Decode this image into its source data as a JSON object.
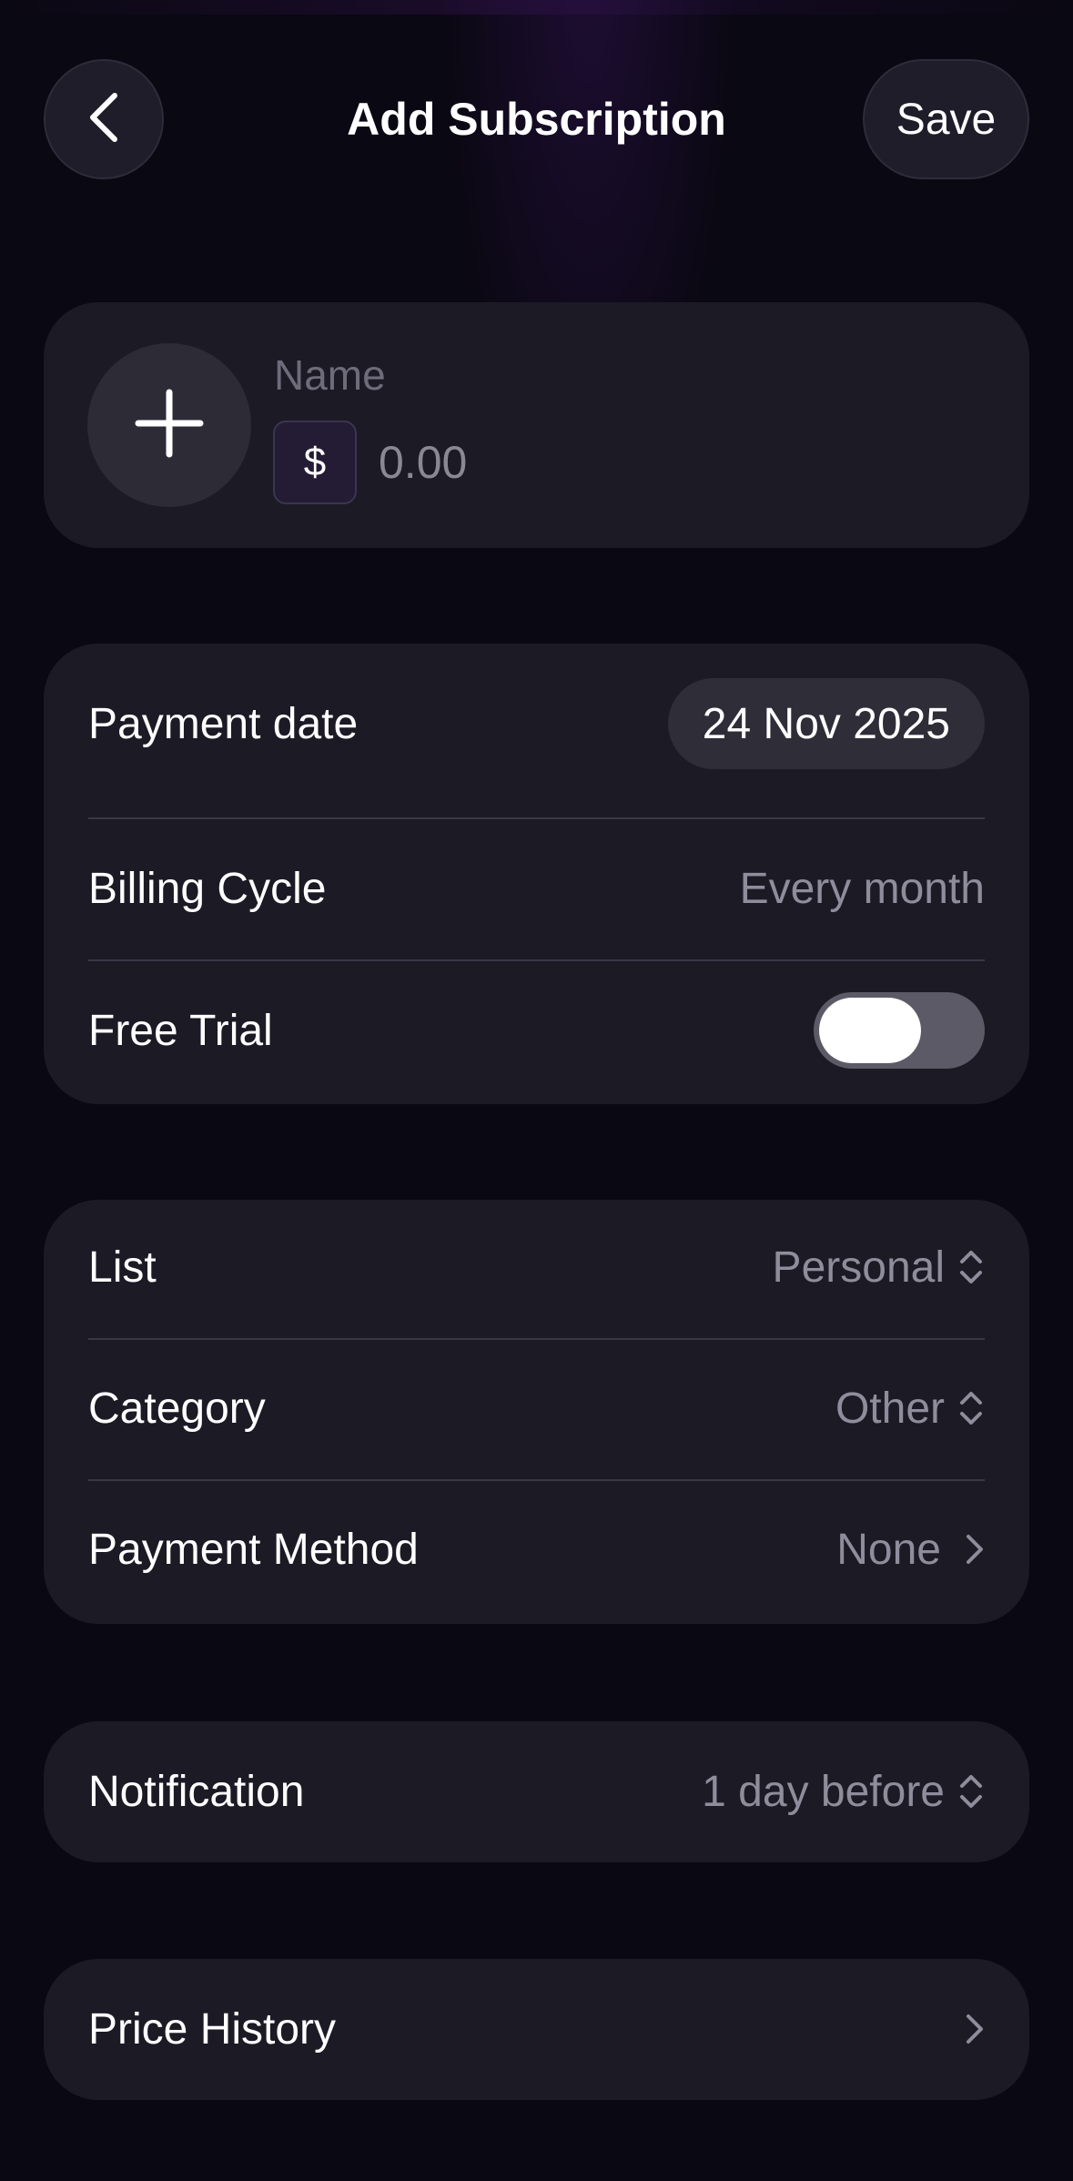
{
  "header": {
    "title": "Add Subscription",
    "save_label": "Save"
  },
  "name_card": {
    "name_placeholder": "Name",
    "currency_symbol": "$",
    "amount_placeholder": "0.00"
  },
  "payment_card": {
    "payment_date_label": "Payment date",
    "payment_date_value": "24 Nov 2025",
    "billing_cycle_label": "Billing Cycle",
    "billing_cycle_value": "Every month",
    "free_trial_label": "Free Trial",
    "free_trial_on": false
  },
  "list_card": {
    "list_label": "List",
    "list_value": "Personal",
    "category_label": "Category",
    "category_value": "Other",
    "payment_method_label": "Payment Method",
    "payment_method_value": "None"
  },
  "notification_card": {
    "label": "Notification",
    "value": "1 day before"
  },
  "price_history_card": {
    "label": "Price History"
  },
  "icons": {
    "back": "chevron-left-icon",
    "add": "plus-icon",
    "updown": "chevron-up-down-icon",
    "right": "chevron-right-icon"
  },
  "colors": {
    "background": "#0a0812",
    "card": "#1b1a25",
    "secondary_text": "#8f8d9b",
    "toggle_off": "#5b5a66"
  }
}
